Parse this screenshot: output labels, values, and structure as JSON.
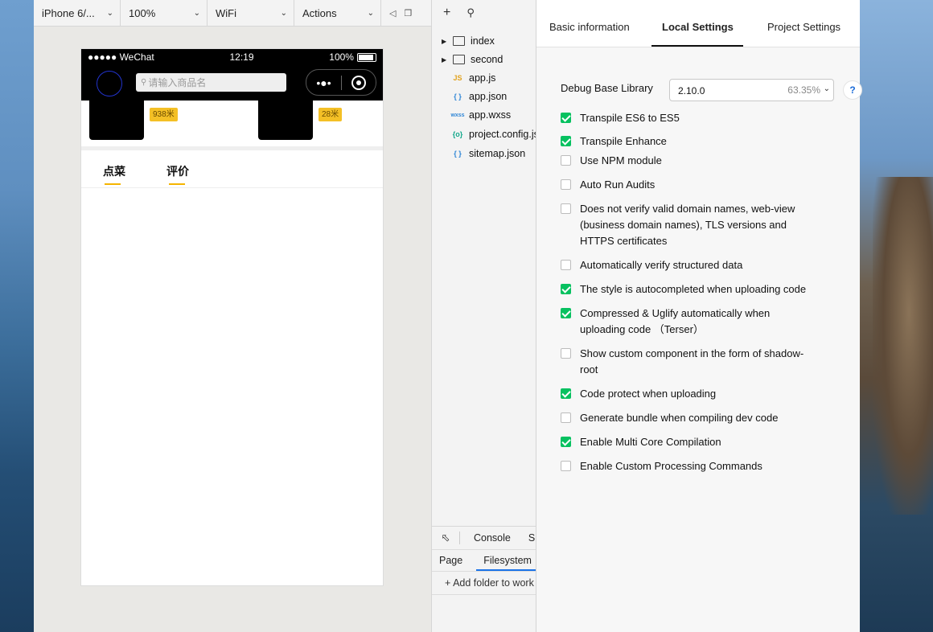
{
  "toolbar": {
    "device": "iPhone 6/...",
    "zoom": "100%",
    "network": "WiFi",
    "actions": "Actions"
  },
  "phone": {
    "status": {
      "carrier": "●●●●● WeChat",
      "time": "12:19",
      "battery": "100%"
    },
    "search_placeholder": "请输入商品名",
    "shops": [
      {
        "distance": "938米"
      },
      {
        "distance": "28米"
      }
    ],
    "tabs": [
      "点菜",
      "评价"
    ]
  },
  "file_tree": {
    "items": [
      {
        "name": "index",
        "type": "folder"
      },
      {
        "name": "second",
        "type": "folder"
      },
      {
        "name": "app.js",
        "type": "js",
        "icon": "JS",
        "color": "#e2a31f"
      },
      {
        "name": "app.json",
        "type": "json",
        "icon": "{ }",
        "color": "#2f86d6"
      },
      {
        "name": "app.wxss",
        "type": "wxss",
        "icon": "wxss",
        "color": "#2f86d6"
      },
      {
        "name": "project.config.json",
        "type": "json",
        "icon": "{o}",
        "color": "#13a88b"
      },
      {
        "name": "sitemap.json",
        "type": "json",
        "icon": "{ }",
        "color": "#2f86d6"
      }
    ],
    "bottom": {
      "console_tab": "Console",
      "next_tab": "S",
      "page_tab": "Page",
      "filesystem_tab": "Filesystem",
      "add_folder": "+ Add folder to work"
    }
  },
  "settings": {
    "tabs": [
      "Basic information",
      "Local Settings",
      "Project Settings"
    ],
    "active_tab": "Local Settings",
    "debug_lib": {
      "label": "Debug Base Library",
      "version": "2.10.0",
      "percent": "63.35%"
    },
    "help": "?",
    "options": [
      {
        "label": "Transpile ES6 to ES5",
        "checked": true
      },
      {
        "label": "Transpile Enhance",
        "checked": true
      },
      {
        "label": "Use NPM module",
        "checked": false
      },
      {
        "label": "Auto Run Audits",
        "checked": false
      },
      {
        "label": "Does not verify valid domain names, web-view (business domain names), TLS versions and HTTPS certificates",
        "checked": false
      },
      {
        "label": "Automatically verify structured data",
        "checked": false
      },
      {
        "label": "The style is autocompleted when uploading code",
        "checked": true
      },
      {
        "label": "Compressed & Uglify automatically when uploading code （Terser）",
        "checked": true
      },
      {
        "label": "Show custom component in the form of shadow-root",
        "checked": false
      },
      {
        "label": "Code protect when uploading",
        "checked": true
      },
      {
        "label": "Generate bundle when compiling dev code",
        "checked": false
      },
      {
        "label": "Enable Multi Core Compilation",
        "checked": true
      },
      {
        "label": "Enable Custom Processing Commands",
        "checked": false
      }
    ],
    "accent": "#07c160"
  }
}
